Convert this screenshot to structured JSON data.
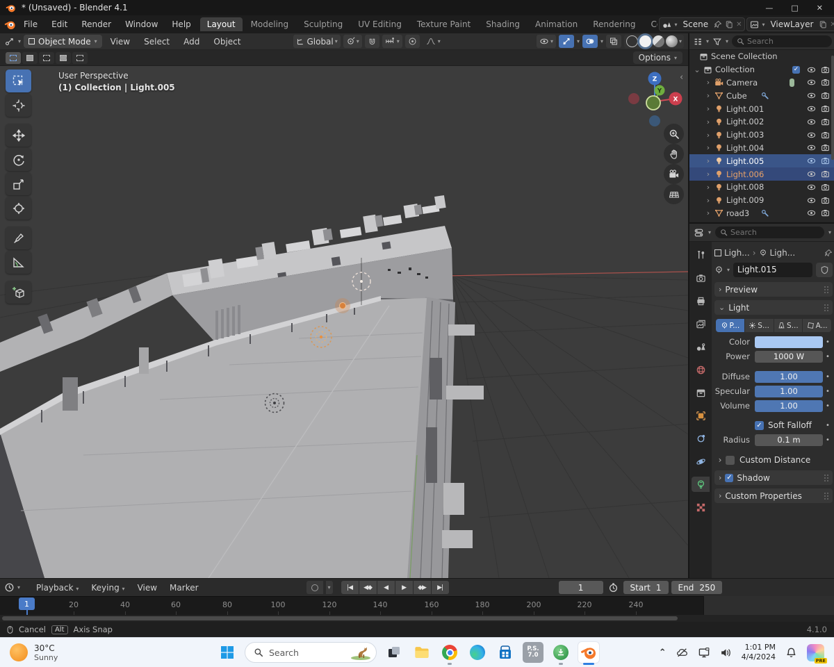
{
  "window": {
    "title": "* (Unsaved) - Blender 4.1",
    "minimize": "—",
    "maximize": "□",
    "close": "✕"
  },
  "menubar": {
    "menus": [
      "File",
      "Edit",
      "Render",
      "Window",
      "Help"
    ],
    "workspaces": [
      "Layout",
      "Modeling",
      "Sculpting",
      "UV Editing",
      "Texture Paint",
      "Shading",
      "Animation",
      "Rendering",
      "Compos"
    ],
    "active_workspace": "Layout",
    "scene_name": "Scene",
    "viewlayer_name": "ViewLayer"
  },
  "tool_header": {
    "mode": "Object Mode",
    "menus": [
      "View",
      "Select",
      "Add",
      "Object"
    ],
    "orientation": "Global",
    "options_label": "Options"
  },
  "viewport": {
    "perspective_label": "User Perspective",
    "context_label": "(1) Collection | Light.005",
    "axis": {
      "x": "X",
      "y": "Y",
      "z": "Z"
    },
    "icons": [
      "select-box",
      "cursor",
      "move",
      "rotate",
      "scale",
      "transform",
      "annotate",
      "measure",
      "add-cube",
      "zoom",
      "pan-hand",
      "camera-view",
      "toggle-grid"
    ]
  },
  "outliner": {
    "search_placeholder": "Search",
    "scene_collection": "Scene Collection",
    "collection": "Collection",
    "items": [
      {
        "name": "Camera",
        "icon": "camera"
      },
      {
        "name": "Cube",
        "icon": "mesh",
        "modifier": "wrench"
      },
      {
        "name": "Light.001",
        "icon": "light"
      },
      {
        "name": "Light.002",
        "icon": "light"
      },
      {
        "name": "Light.003",
        "icon": "light"
      },
      {
        "name": "Light.004",
        "icon": "light"
      },
      {
        "name": "Light.005",
        "icon": "light",
        "selected": true,
        "active": true
      },
      {
        "name": "Light.006",
        "icon": "light",
        "selected": true
      },
      {
        "name": "Light.008",
        "icon": "light"
      },
      {
        "name": "Light.009",
        "icon": "light"
      },
      {
        "name": "road3",
        "icon": "mesh",
        "modifier": "wrench"
      }
    ]
  },
  "properties": {
    "search_placeholder": "Search",
    "breadcrumb_object": "Ligh...",
    "breadcrumb_data": "Ligh...",
    "id_name": "Light.015",
    "preview_label": "Preview",
    "light_label": "Light",
    "type_buttons": [
      "P...",
      "S...",
      "S...",
      "A..."
    ],
    "active_type": "P...",
    "color_label": "Color",
    "color_value": "#a9c8f2",
    "power_label": "Power",
    "power_value": "1000 W",
    "diffuse_label": "Diffuse",
    "diffuse_value": "1.00",
    "specular_label": "Specular",
    "specular_value": "1.00",
    "volume_label": "Volume",
    "volume_value": "1.00",
    "soft_falloff_label": "Soft Falloff",
    "radius_label": "Radius",
    "radius_value": "0.1 m",
    "custom_distance_label": "Custom Distance",
    "shadow_label": "Shadow",
    "custom_properties_label": "Custom Properties",
    "check_glyph": "✓",
    "tab_icons": [
      "tool",
      "render",
      "output",
      "view-layer",
      "scene",
      "world",
      "collection",
      "object",
      "constraints",
      "physics",
      "object-data",
      "texture"
    ]
  },
  "timeline": {
    "menus": [
      "Playback",
      "Keying",
      "View",
      "Marker"
    ],
    "current_frame": "1",
    "frame_field": "1",
    "start_label": "Start",
    "start_value": "1",
    "end_label": "End",
    "end_value": "250",
    "ticks": [
      "20",
      "40",
      "60",
      "80",
      "100",
      "120",
      "140",
      "160",
      "180",
      "200",
      "220",
      "240"
    ],
    "transport": [
      "|◀",
      "◀◆",
      "◀",
      "▶",
      "◆▶",
      "▶|"
    ]
  },
  "statusbar": {
    "cancel_label": "Cancel",
    "key_label": "Alt",
    "hint_label": "Axis Snap",
    "version": "4.1.0"
  },
  "taskbar": {
    "weather_temp": "30°C",
    "weather_desc": "Sunny",
    "search_placeholder": "Search",
    "ps_line1": "P.S.",
    "ps_line2": "7.0",
    "time": "1:01 PM",
    "date": "4/4/2024",
    "copilot_badge": "PRE",
    "tray_icons": [
      "hidden-icons-chevron",
      "onedrive-paused",
      "display",
      "volume",
      "notifications",
      "copilot"
    ]
  }
}
